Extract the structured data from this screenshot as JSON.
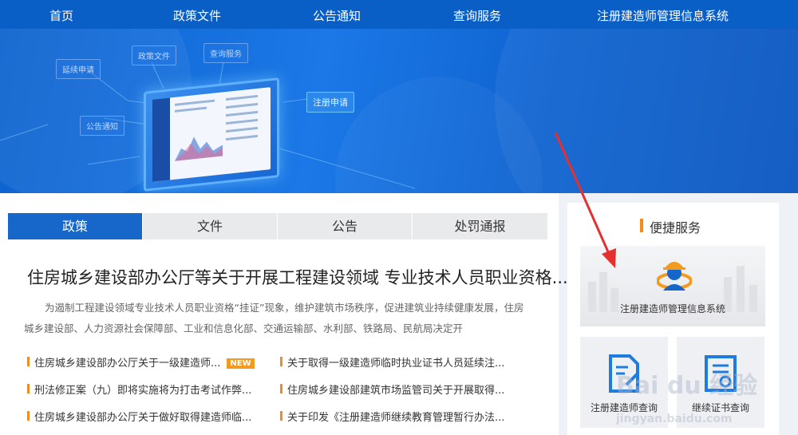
{
  "nav": {
    "items": [
      "首页",
      "政策文件",
      "公告通知",
      "查询服务",
      "注册建造师管理信息系统"
    ]
  },
  "banner": {
    "tags": [
      "延续申请",
      "政策文件",
      "查询服务",
      "公告通知",
      "注册申请"
    ]
  },
  "tabs": [
    "政策",
    "文件",
    "公告",
    "处罚通报"
  ],
  "headline": "住房城乡建设部办公厅等关于开展工程建设领域 专业技术人员职业资格...",
  "summary": "为遏制工程建设领域专业技术人员职业资格“挂证”现象，维护建筑市场秩序，促进建筑业持续健康发展，住房城乡建设部、人力资源社会保障部、工业和信息化部、交通运输部、水利部、铁路局、民航局决定开",
  "news": {
    "left": [
      "住房城乡建设部办公厅关于一级建造师...",
      "刑法修正案（九）即将实施将为打击考试作弊...",
      "住房城乡建设部办公厅关于做好取得建造师临..."
    ],
    "right": [
      "关于取得一级建造师临时执业证书人员延续注...",
      "住房城乡建设部建筑市场监管司关于开展取得...",
      "关于印发《注册建造师继续教育管理暂行办法..."
    ],
    "badge": "NEW"
  },
  "services": {
    "title": "便捷服务",
    "big_card": "注册建造师管理信息系统",
    "card_left": "注册建造师查询",
    "card_right": "继续证书查询"
  },
  "watermark": {
    "main": "Bai du 经验",
    "sub": "jingyan.baidu.com"
  },
  "colors": {
    "nav": "#0a5fc7",
    "tab_active": "#1667c9",
    "accent_orange": "#f08c21",
    "arrow": "#e53030"
  }
}
